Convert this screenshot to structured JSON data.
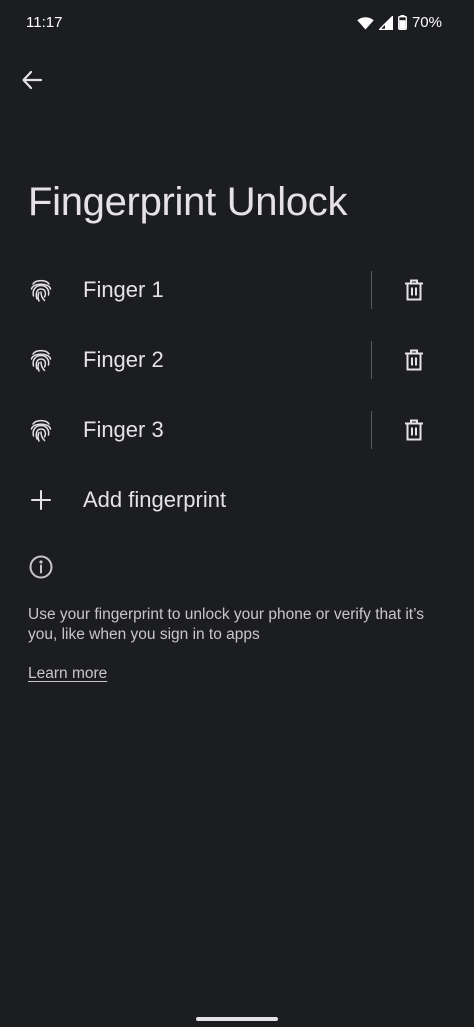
{
  "status_bar": {
    "time": "11:17",
    "battery": "70%",
    "icons": [
      "wifi-icon",
      "cellular-signal-icon",
      "battery-icon"
    ]
  },
  "header": {
    "back_icon": "arrow-back-icon",
    "title": "Fingerprint Unlock"
  },
  "fingerprints": [
    {
      "label": "Finger 1",
      "icon": "fingerprint-icon",
      "action_icon": "delete-icon"
    },
    {
      "label": "Finger 2",
      "icon": "fingerprint-icon",
      "action_icon": "delete-icon"
    },
    {
      "label": "Finger 3",
      "icon": "fingerprint-icon",
      "action_icon": "delete-icon"
    }
  ],
  "add_fingerprint": {
    "label": "Add fingerprint",
    "icon": "plus-icon"
  },
  "info": {
    "icon": "info-icon",
    "text": "Use your fingerprint to unlock your phone or verify that it’s you, like when you sign in to apps",
    "link": "Learn more"
  },
  "colors": {
    "background": "#1c1d21",
    "text": "#e6e1e5",
    "secondary_text": "#c8c6cc",
    "divider": "#5a5a60"
  }
}
